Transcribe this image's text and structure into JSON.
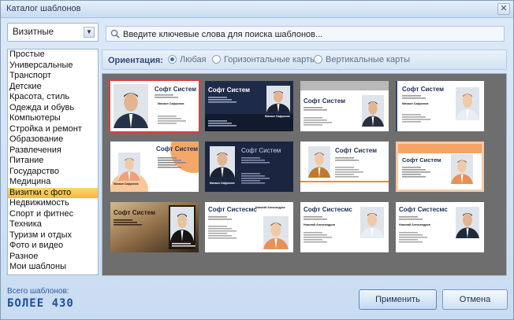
{
  "window": {
    "title": "Каталог шаблонов",
    "close_glyph": "✕"
  },
  "category_select": {
    "value": "Визитные"
  },
  "categories": [
    "Простые",
    "Универсальные",
    "Транспорт",
    "Детские",
    "Красота, стиль",
    "Одежда и обувь",
    "Компьютеры",
    "Стройка и ремонт",
    "Образование",
    "Развлечения",
    "Питание",
    "Государство",
    "Медицина",
    "Визитки с фото",
    "Недвижимость",
    "Спорт и фитнес",
    "Техника",
    "Туризм и отдых",
    "Фото и видео",
    "Разное",
    "Мои шаблоны"
  ],
  "selected_category": "Визитки с фото",
  "search": {
    "placeholder": "Введите ключевые слова для поиска шаблонов..."
  },
  "orientation": {
    "label": "Ориентация:",
    "options": [
      "Любая",
      "Горизонтальные карты",
      "Вертикальные карты"
    ],
    "selected": "Любая"
  },
  "templates": [
    {
      "company": "Софт Систем",
      "name": "Михаил Сафронов",
      "style": "white-left-photo",
      "selected": true
    },
    {
      "company": "Софт Систем",
      "name": "Михаил Сафронов",
      "style": "dark-navy"
    },
    {
      "company": "Софт Систем",
      "name": "Михаил Сафронов",
      "style": "grey-band"
    },
    {
      "company": "Софт Систем",
      "name": "Михаил Сафронов",
      "style": "white-right-photo"
    },
    {
      "company": "Софт Систем",
      "name": "Михаил Сафронов",
      "style": "orange-circle"
    },
    {
      "company": "Софт Систем",
      "name": "Михаил Сафронов",
      "style": "navy-photo"
    },
    {
      "company": "Софт Систем",
      "name": "Михаил Сафронов",
      "style": "white-orange-line"
    },
    {
      "company": "Софт Систем",
      "name": "Михаил Сафронов",
      "style": "orange-frame"
    },
    {
      "company": "Софт Систем",
      "name": "Михаил Сафронов",
      "style": "sepia-dramatic"
    },
    {
      "company": "Софт Систесмс",
      "name": "Николай Александров",
      "style": "white-photo-bottom"
    },
    {
      "company": "Софт Систесмс",
      "name": "Николай Александров",
      "style": "white-photo-right"
    },
    {
      "company": "Софт Систесмс",
      "name": "Николай Александров",
      "style": "white-photo-right-2"
    }
  ],
  "footer": {
    "total_label": "Всего шаблонов:",
    "total_value": "БОЛЕЕ 430",
    "apply_label": "Применить",
    "cancel_label": "Отмена"
  },
  "colors": {
    "accent": "#f6b93a",
    "selection": "#d9413c",
    "title_blue": "#2d4a78"
  }
}
